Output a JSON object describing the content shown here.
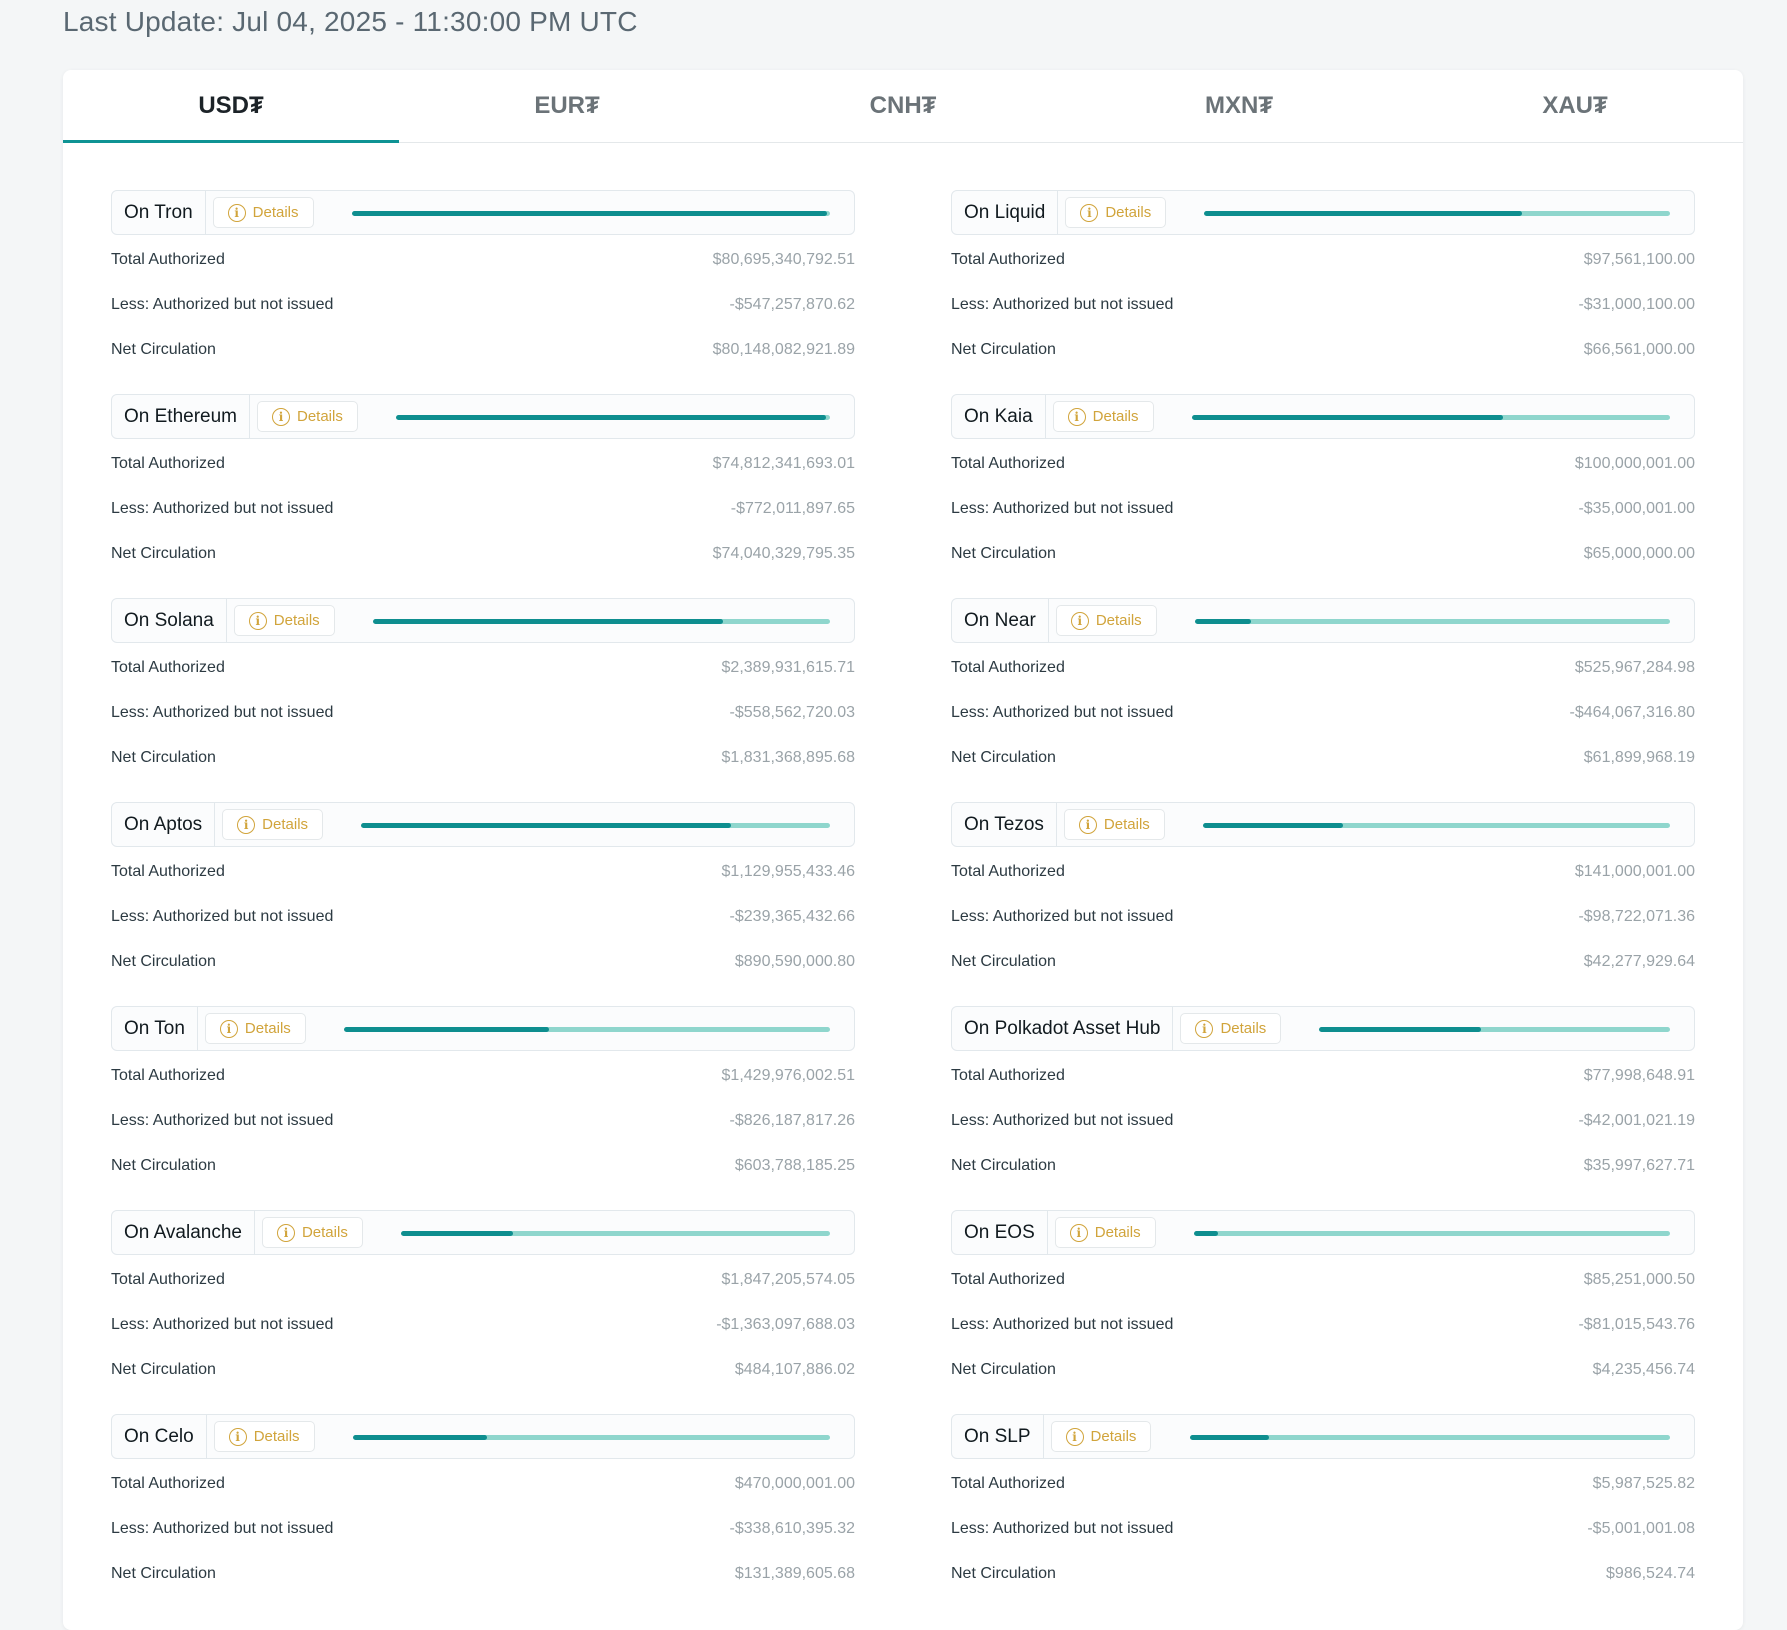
{
  "last_update": "Last Update: Jul 04, 2025 - 11:30:00 PM UTC",
  "tabs": [
    {
      "label": "USD₮",
      "active": true
    },
    {
      "label": "EUR₮",
      "active": false
    },
    {
      "label": "CNH₮",
      "active": false
    },
    {
      "label": "MXN₮",
      "active": false
    },
    {
      "label": "XAU₮",
      "active": false
    }
  ],
  "labels": {
    "details": "Details",
    "total_authorized": "Total Authorized",
    "less_authorized": "Less: Authorized but not issued",
    "net_circulation": "Net Circulation"
  },
  "colors": {
    "accent": "#0e8e8f",
    "bar_track": "#8fd6cd",
    "details": "#d1a43b"
  },
  "chains": [
    {
      "name": "On Tron",
      "total_authorized": "$80,695,340,792.51",
      "not_issued": "-$547,257,870.62",
      "net_circulation": "$80,148,082,921.89",
      "circulation_fraction": 0.993
    },
    {
      "name": "On Liquid",
      "total_authorized": "$97,561,100.00",
      "not_issued": "-$31,000,100.00",
      "net_circulation": "$66,561,000.00",
      "circulation_fraction": 0.682
    },
    {
      "name": "On Ethereum",
      "total_authorized": "$74,812,341,693.01",
      "not_issued": "-$772,011,897.65",
      "net_circulation": "$74,040,329,795.35",
      "circulation_fraction": 0.99
    },
    {
      "name": "On Kaia",
      "total_authorized": "$100,000,001.00",
      "not_issued": "-$35,000,001.00",
      "net_circulation": "$65,000,000.00",
      "circulation_fraction": 0.65
    },
    {
      "name": "On Solana",
      "total_authorized": "$2,389,931,615.71",
      "not_issued": "-$558,562,720.03",
      "net_circulation": "$1,831,368,895.68",
      "circulation_fraction": 0.766
    },
    {
      "name": "On Near",
      "total_authorized": "$525,967,284.98",
      "not_issued": "-$464,067,316.80",
      "net_circulation": "$61,899,968.19",
      "circulation_fraction": 0.118
    },
    {
      "name": "On Aptos",
      "total_authorized": "$1,129,955,433.46",
      "not_issued": "-$239,365,432.66",
      "net_circulation": "$890,590,000.80",
      "circulation_fraction": 0.788
    },
    {
      "name": "On Tezos",
      "total_authorized": "$141,000,001.00",
      "not_issued": "-$98,722,071.36",
      "net_circulation": "$42,277,929.64",
      "circulation_fraction": 0.3
    },
    {
      "name": "On Ton",
      "total_authorized": "$1,429,976,002.51",
      "not_issued": "-$826,187,817.26",
      "net_circulation": "$603,788,185.25",
      "circulation_fraction": 0.422
    },
    {
      "name": "On Polkadot Asset Hub",
      "total_authorized": "$77,998,648.91",
      "not_issued": "-$42,001,021.19",
      "net_circulation": "$35,997,627.71",
      "circulation_fraction": 0.462
    },
    {
      "name": "On Avalanche",
      "total_authorized": "$1,847,205,574.05",
      "not_issued": "-$1,363,097,688.03",
      "net_circulation": "$484,107,886.02",
      "circulation_fraction": 0.262
    },
    {
      "name": "On EOS",
      "total_authorized": "$85,251,000.50",
      "not_issued": "-$81,015,543.76",
      "net_circulation": "$4,235,456.74",
      "circulation_fraction": 0.05
    },
    {
      "name": "On Celo",
      "total_authorized": "$470,000,001.00",
      "not_issued": "-$338,610,395.32",
      "net_circulation": "$131,389,605.68",
      "circulation_fraction": 0.28
    },
    {
      "name": "On SLP",
      "total_authorized": "$5,987,525.82",
      "not_issued": "-$5,001,001.08",
      "net_circulation": "$986,524.74",
      "circulation_fraction": 0.165
    }
  ]
}
